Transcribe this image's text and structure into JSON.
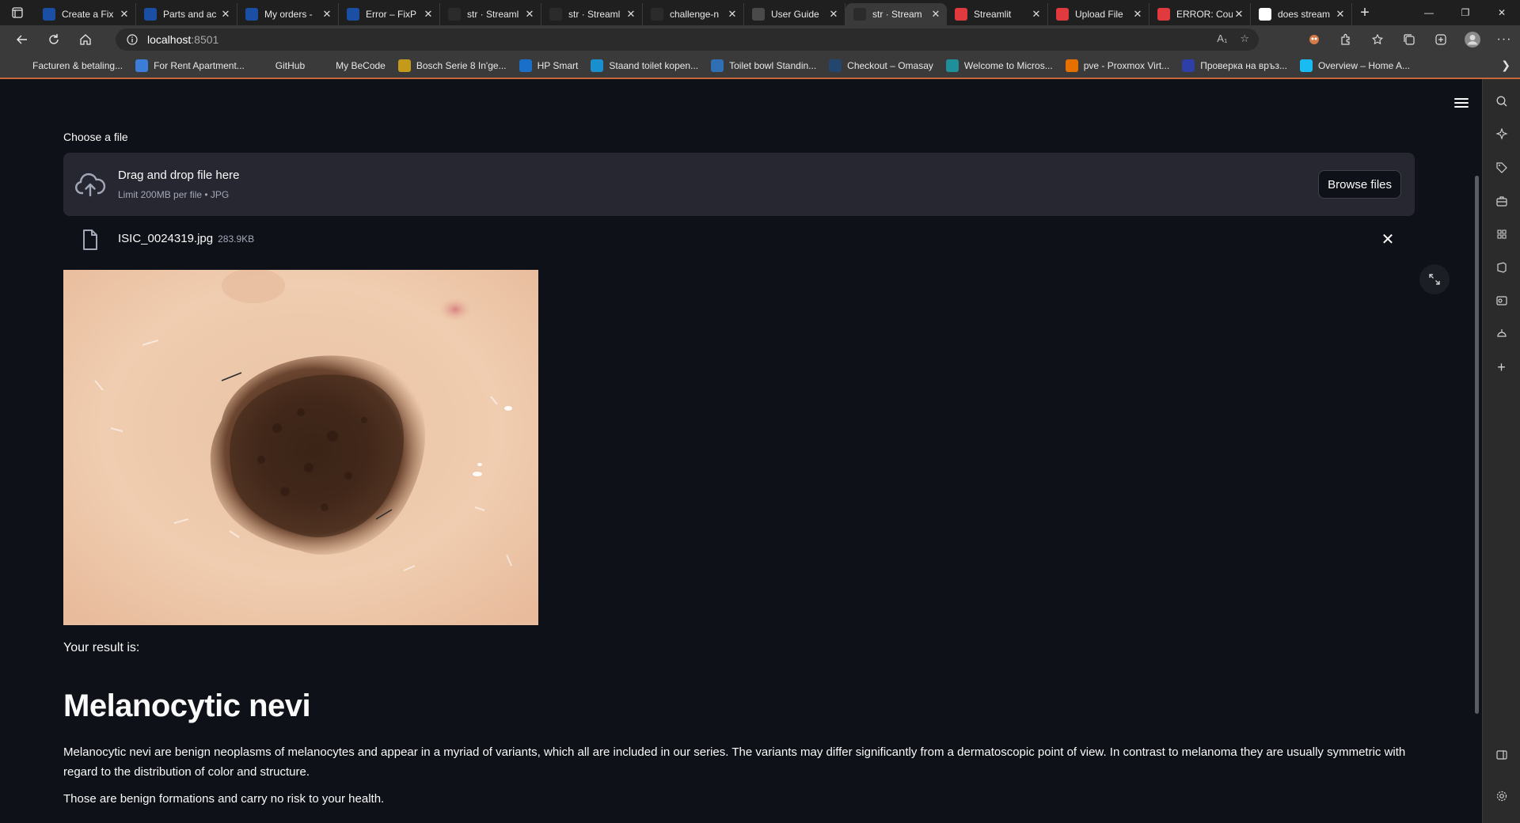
{
  "browser": {
    "tabs": [
      {
        "title": "Create a Fix",
        "favicon": "fixp-icon",
        "color": "#1a4fa3",
        "active": false
      },
      {
        "title": "Parts and ac",
        "favicon": "fixp-icon",
        "color": "#1a4fa3",
        "active": false
      },
      {
        "title": "My orders -",
        "favicon": "fixp-icon",
        "color": "#1a4fa3",
        "active": false
      },
      {
        "title": "Error – FixP",
        "favicon": "fixp-icon",
        "color": "#1a4fa3",
        "active": false
      },
      {
        "title": "str · Streaml",
        "favicon": "streamlit-crown-icon",
        "color": "#2b2b2b",
        "active": false
      },
      {
        "title": "str · Streaml",
        "favicon": "streamlit-crown-icon",
        "color": "#2b2b2b",
        "active": false
      },
      {
        "title": "challenge-n",
        "favicon": "github-icon",
        "color": "#2b2b2b",
        "active": false
      },
      {
        "title": "User Guide",
        "favicon": "docs-icon",
        "color": "#4a4a4a",
        "active": false
      },
      {
        "title": "str · Stream",
        "favicon": "streamlit-crown-icon",
        "color": "#2b2b2b",
        "active": true
      },
      {
        "title": "Streamlit",
        "favicon": "streamlit-red-icon",
        "color": "#e0393e",
        "active": false
      },
      {
        "title": "Upload File",
        "favicon": "streamlit-red-icon",
        "color": "#e0393e",
        "active": false
      },
      {
        "title": "ERROR: Cou",
        "favicon": "streamlit-red-icon",
        "color": "#e0393e",
        "active": false
      },
      {
        "title": "does stream",
        "favicon": "google-icon",
        "color": "#ffffff",
        "active": false
      }
    ],
    "url_host": "localhost",
    "url_port": ":8501",
    "bookmarks": [
      {
        "label": "Facturen & betaling...",
        "icon": "page-icon",
        "color": "#3a3a3a"
      },
      {
        "label": "For Rent Apartment...",
        "icon": "globe-icon",
        "color": "#3b7dd8"
      },
      {
        "label": "GitHub",
        "icon": "github-icon",
        "color": "#3a3a3a"
      },
      {
        "label": "My BeCode",
        "icon": "becode-icon",
        "color": "#3a3a3a"
      },
      {
        "label": "Bosch Serie 8 In'ge...",
        "icon": "bosch-icon",
        "color": "#c49a1a"
      },
      {
        "label": "HP Smart",
        "icon": "hp-icon",
        "color": "#1a6fc9"
      },
      {
        "label": "Staand toilet kopen...",
        "icon": "s-icon",
        "color": "#1a8fd0"
      },
      {
        "label": "Toilet bowl Standin...",
        "icon": "toilet-icon",
        "color": "#2f6fb5"
      },
      {
        "label": "Checkout – Omasay",
        "icon": "omasay-icon",
        "color": "#23466e"
      },
      {
        "label": "Welcome to Micros...",
        "icon": "edge-icon",
        "color": "#1f8f9a"
      },
      {
        "label": "pve - Proxmox Virt...",
        "icon": "proxmox-icon",
        "color": "#e57000"
      },
      {
        "label": "Проверка на връз...",
        "icon": "speedtest-icon",
        "color": "#2f3fa8"
      },
      {
        "label": "Overview – Home A...",
        "icon": "homeassistant-icon",
        "color": "#18bcf2"
      }
    ]
  },
  "app": {
    "uploader_label": "Choose a file",
    "dropzone_title": "Drag and drop file here",
    "dropzone_limit": "Limit 200MB per file • JPG",
    "browse_label": "Browse files",
    "file_name": "ISIC_0024319.jpg",
    "file_size": "283.9KB",
    "result_label": "Your result is:",
    "result_title": "Melanocytic nevi",
    "result_description": "Melanocytic nevi are benign neoplasms of melanocytes and appear in a myriad of variants, which all are included in our series. The variants may differ significantly from a dermatoscopic point of view. In contrast to melanoma they are usually symmetric with regard to the distribution of color and structure.",
    "result_health": "Those are benign formations and carry no risk to your health."
  },
  "colors": {
    "app_background": "#0e1117",
    "dropzone_background": "#262730",
    "text_primary": "#fafafa",
    "text_secondary": "#a3a8b8",
    "chrome_tabbar": "#1f1f1f",
    "chrome_toolbar": "#3a3a3a",
    "accent_line": "#c9663c"
  }
}
